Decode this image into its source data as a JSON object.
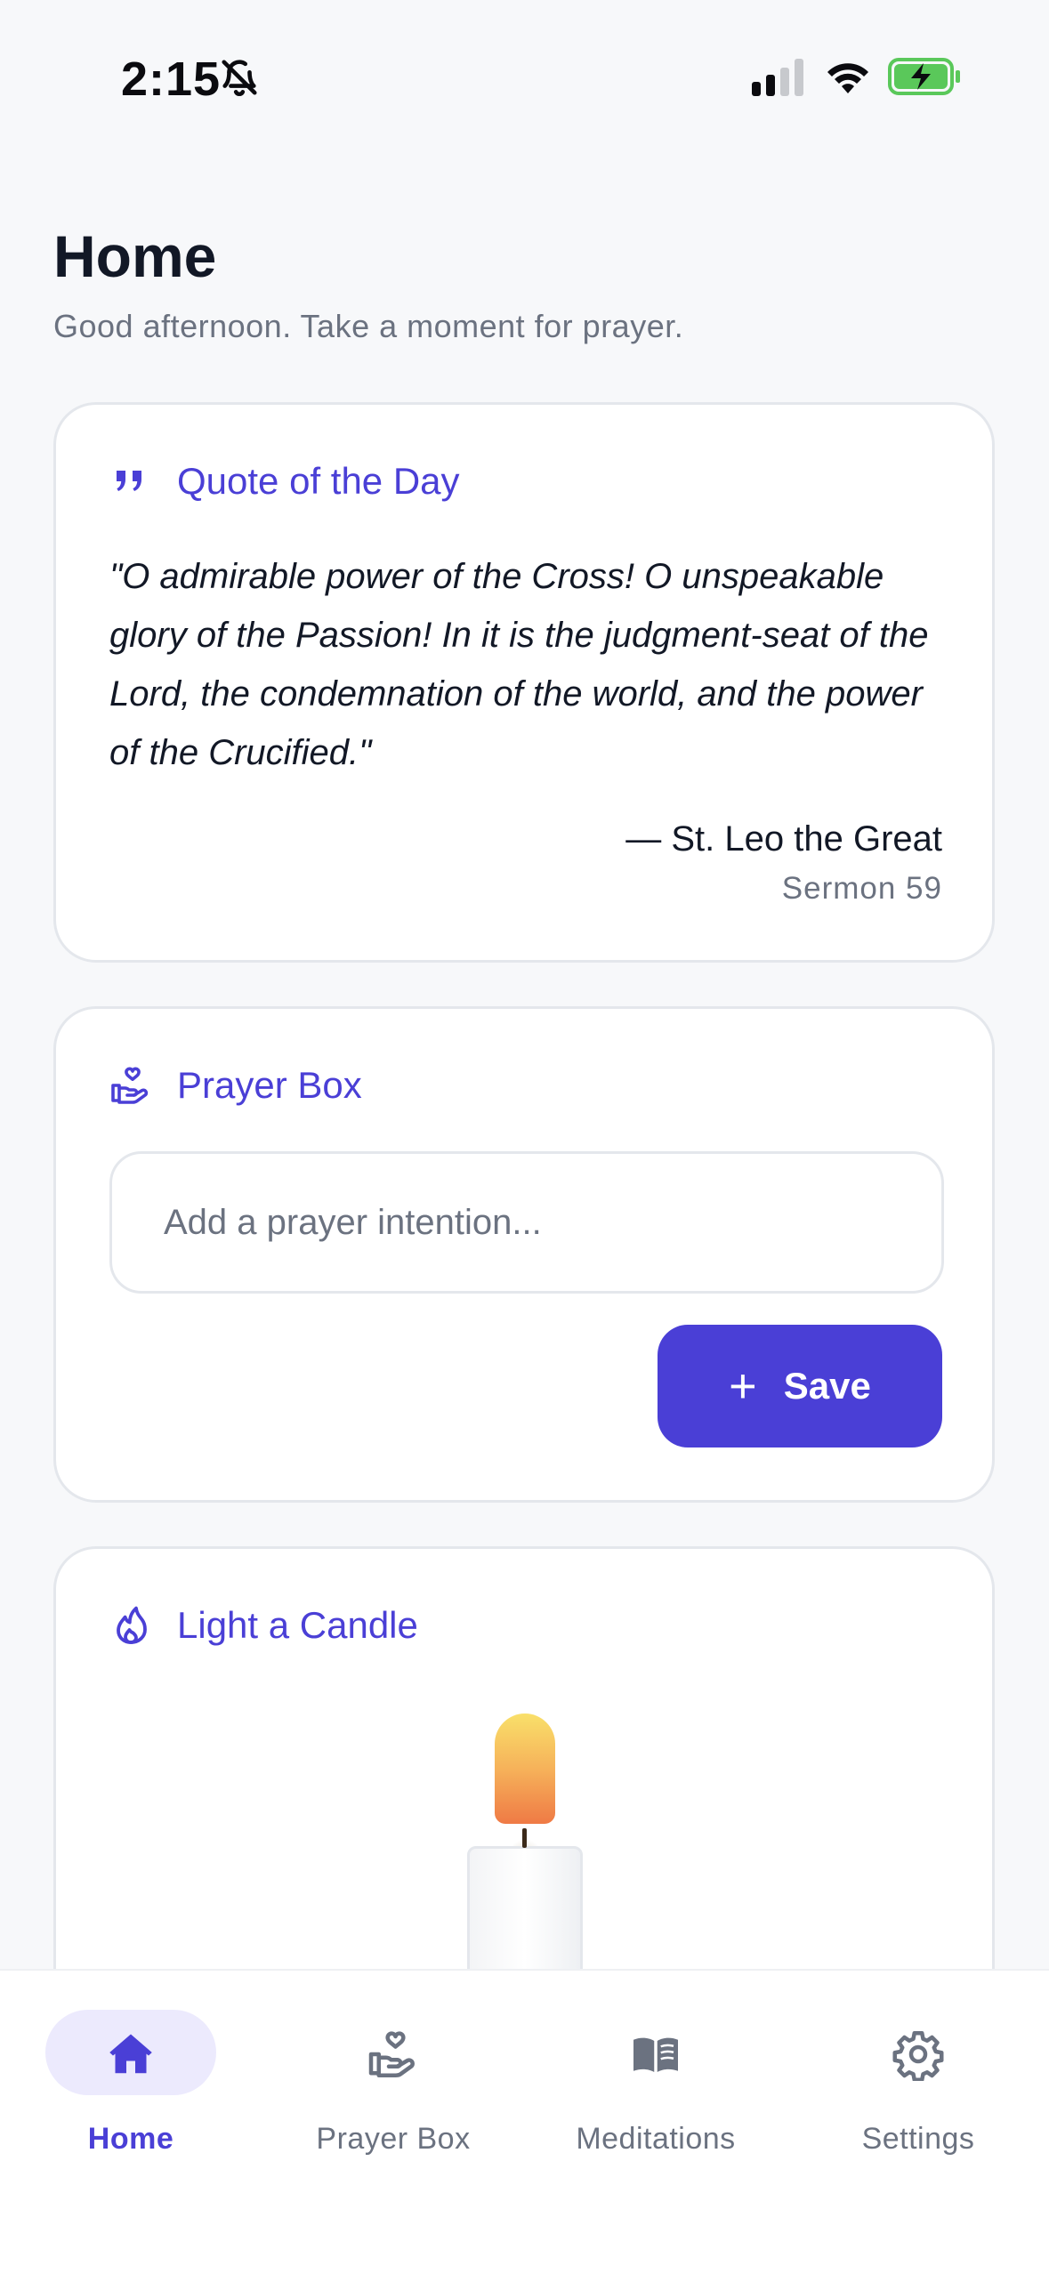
{
  "status_bar": {
    "time": "2:15",
    "icons": [
      "bell-slash-icon",
      "cellular-signal-icon",
      "wifi-icon",
      "battery-charging-icon"
    ]
  },
  "header": {
    "title": "Home",
    "subtitle": "Good afternoon. Take a moment for prayer."
  },
  "quote_card": {
    "icon": "quote-icon",
    "title": "Quote of the Day",
    "text": "\"O admirable power of the Cross! O unspeakable glory of the Passion! In it is the judgment-seat of the Lord, the condemnation of the world, and the power of the Crucified.\"",
    "author": "— St. Leo the Great",
    "source": "Sermon 59"
  },
  "prayer_box_card": {
    "icon": "hand-heart-icon",
    "title": "Prayer Box",
    "input_value": "",
    "input_placeholder": "Add a prayer intention...",
    "save_icon": "plus-icon",
    "save_label": "Save"
  },
  "candle_card": {
    "icon": "flame-icon",
    "title": "Light a Candle"
  },
  "bottom_nav": {
    "items": [
      {
        "label": "Home",
        "icon": "home-icon",
        "active": true
      },
      {
        "label": "Prayer Box",
        "icon": "hand-heart-icon",
        "active": false
      },
      {
        "label": "Meditations",
        "icon": "book-open-icon",
        "active": false
      },
      {
        "label": "Settings",
        "icon": "gear-icon",
        "active": false
      }
    ]
  },
  "colors": {
    "accent": "#4a3fd6",
    "background": "#f7f8fa",
    "card": "#ffffff",
    "muted_text": "#6b7280",
    "active_pill": "#eceafd",
    "battery_green": "#5ac85a"
  }
}
